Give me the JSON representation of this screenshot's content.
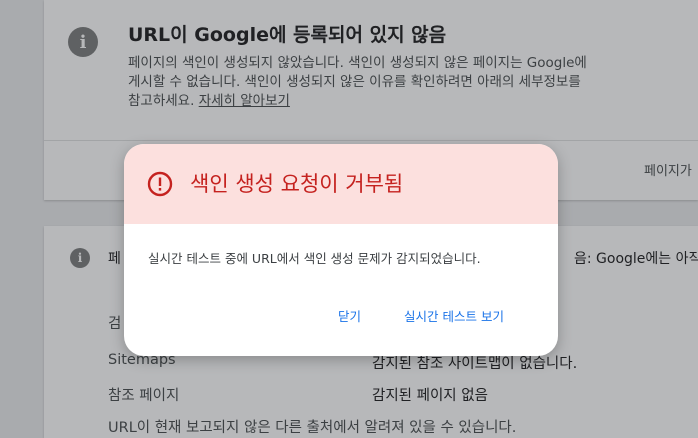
{
  "top_card": {
    "title": "URL이 Google에 등록되어 있지 않음",
    "desc_line1": "페이지의 색인이 생성되지 않았습니다. 색인이 생성되지 않은 페이지는 Google에",
    "desc_line2": "게시할 수 없습니다. 색인이 생성되지 않은 이유를 확인하려면 아래의 세부정보를",
    "desc_line3_prefix": "참고하세요. ",
    "learn_more": "자세히 알아보기",
    "footer_link": "페이지가"
  },
  "bottom_card": {
    "section_head": "페",
    "section_head_right": "음: Google에는 아직",
    "row1_label": "검",
    "row2_label": "Sitemaps",
    "row2_value": "감지된 참조 사이트맵이 없습니다.",
    "row3_label": "참조 페이지",
    "row3_value": "감지된 페이지 없음",
    "note": "URL이 현재 보고되지 않은 다른 출처에서 알려져 있을 수 있습니다."
  },
  "dialog": {
    "title": "색인 생성 요청이 거부됨",
    "body": "실시간 테스트 중에 URL에서 색인 생성 문제가 감지되었습니다.",
    "close_label": "닫기",
    "live_test_label": "실시간 테스트 보기"
  },
  "colors": {
    "error_red": "#c5221f",
    "header_bg": "#fce0de",
    "link_blue": "#1a73e8"
  },
  "icons": {
    "top_card": "info-icon",
    "bottom_card": "info-icon",
    "dialog": "error-circle-icon"
  }
}
